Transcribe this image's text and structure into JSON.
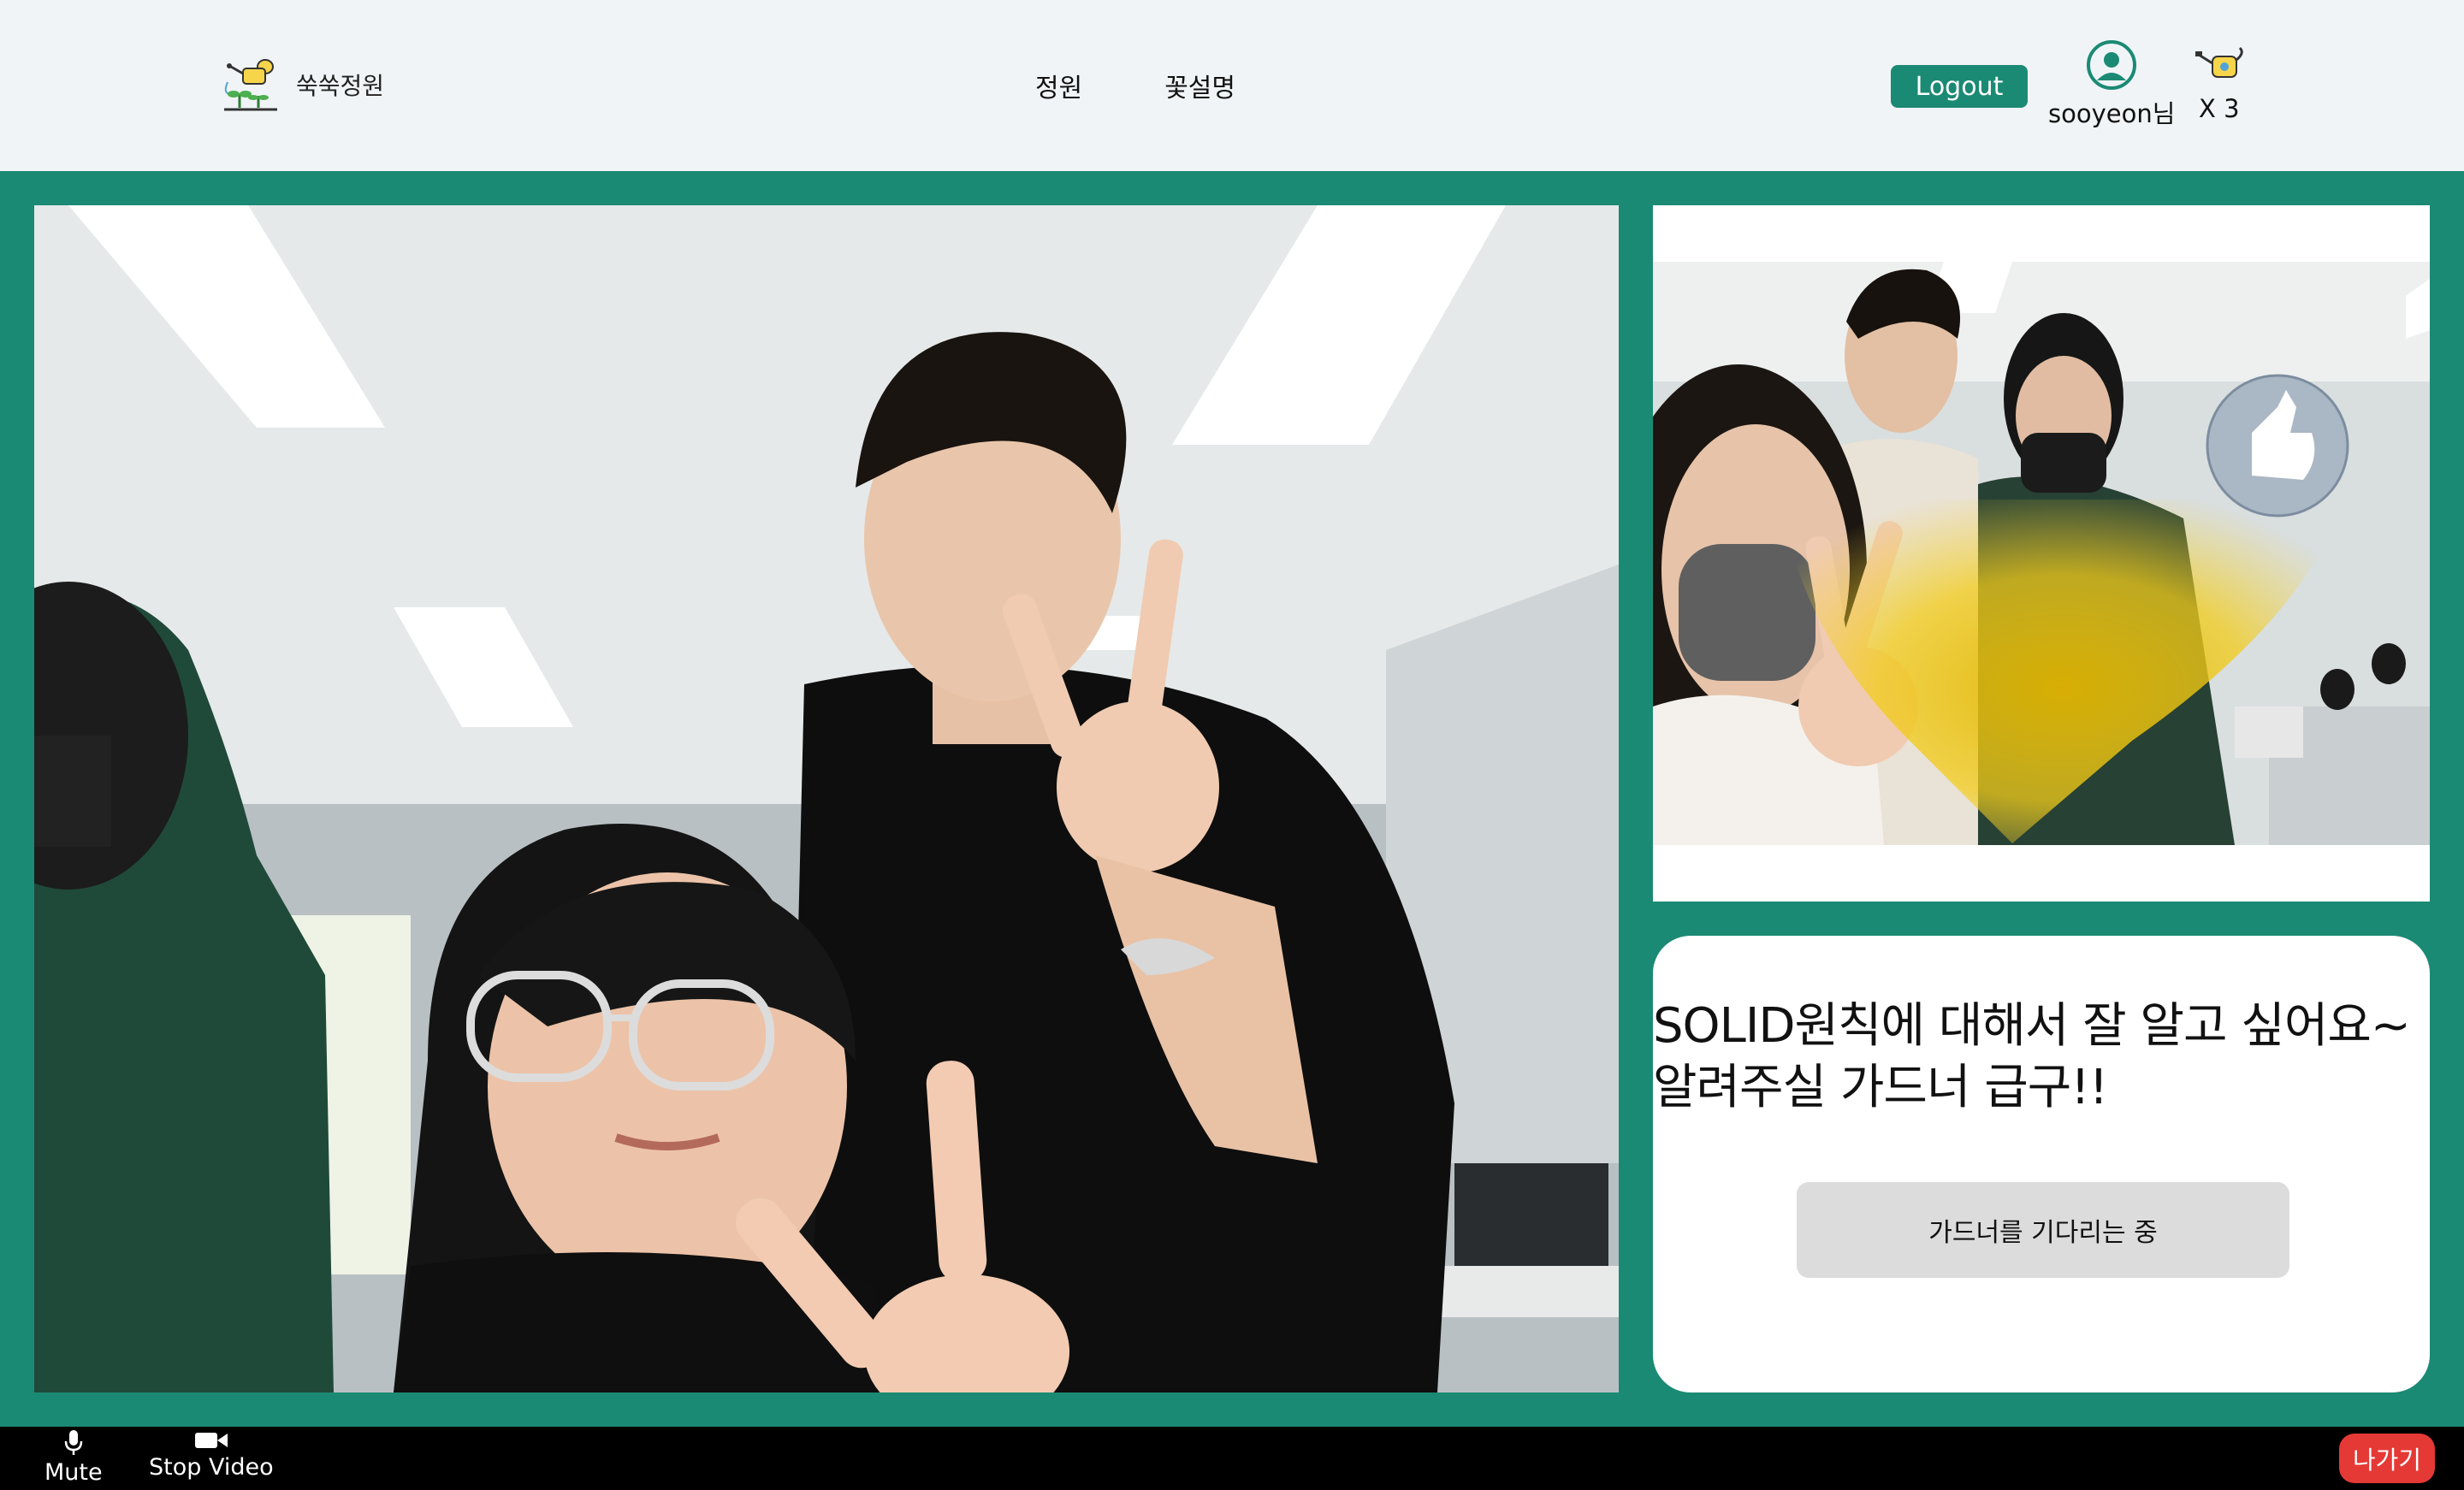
{
  "header": {
    "logo_text": "쑥쑥정원",
    "nav": [
      {
        "label": "정원"
      },
      {
        "label": "꽃설명"
      }
    ],
    "logout_label": "Logout",
    "user_name": "sooyeon님",
    "watering_can_count": "X 3"
  },
  "main_video": {
    "description_icon": "webcam-feed"
  },
  "side_video": {
    "description_icon": "webcam-feed"
  },
  "question": {
    "text": "SOLID원칙에 대해서 잘 알고 싶어요~\n알려주실 가드너 급구!!",
    "wait_label": "가드너를 기다리는 중"
  },
  "controls": {
    "mute_label": "Mute",
    "stop_video_label": "Stop Video",
    "leave_label": "나가기"
  },
  "colors": {
    "brand": "#1b8a74",
    "header_bg": "#f0f4f7",
    "leave": "#e53935",
    "wait_button": "#dcdcdc"
  }
}
